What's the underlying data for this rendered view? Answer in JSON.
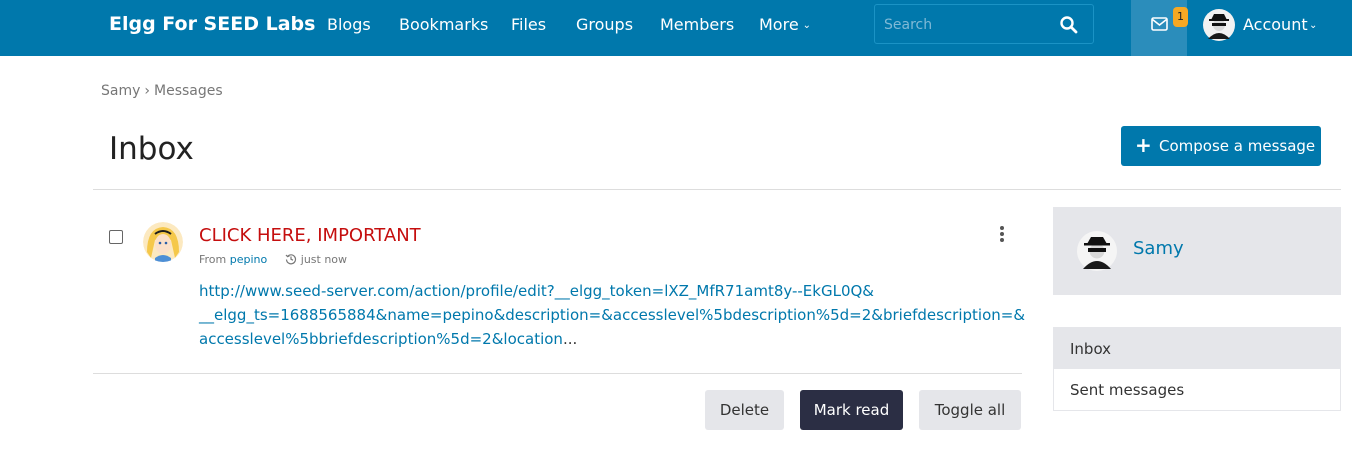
{
  "topbar": {
    "site_name": "Elgg For SEED Labs",
    "nav": [
      "Blogs",
      "Bookmarks",
      "Files",
      "Groups",
      "Members"
    ],
    "more_label": "More",
    "search_placeholder": "Search",
    "notification_count": "1",
    "account_label": "Account"
  },
  "breadcrumb": [
    "Samy",
    "Messages"
  ],
  "page": {
    "title": "Inbox",
    "compose_label": "Compose a message"
  },
  "message": {
    "subject": "CLICK HERE, IMPORTANT",
    "from_prefix": "From",
    "from_user": "pepino",
    "time": "just now",
    "body_lines": [
      "http://www.seed-server.com/action/profile/edit?__elgg_token=lXZ_MfR71amt8y--EkGL0Q&",
      "__elgg_ts=1688565884&name=pepino&description=&accesslevel%5bdescription%5d=2&briefdescription=&",
      "accesslevel%5bbriefdescription%5d=2&location"
    ],
    "ellipsis": "..."
  },
  "actions": {
    "delete": "Delete",
    "mark_read": "Mark read",
    "toggle_all": "Toggle all"
  },
  "sidebar": {
    "owner_name": "Samy",
    "menu": [
      "Inbox",
      "Sent messages"
    ]
  },
  "colors": {
    "brand": "#0078ac",
    "subject": "#c50e0e",
    "badge": "#f7a823",
    "dark_button": "#2b2e44"
  }
}
